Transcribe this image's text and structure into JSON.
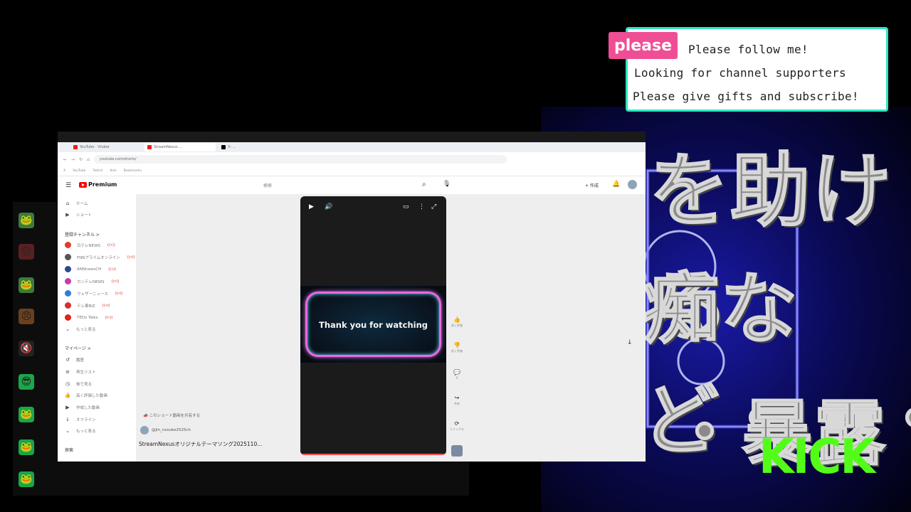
{
  "overlay": {
    "please_tag": "please",
    "lines": [
      "Please follow me!",
      "Looking for channel supporters",
      "Please give gifts and subscribe!"
    ],
    "accent_color": "#2ee6c1",
    "tag_color": "#f04e94"
  },
  "background_text": {
    "line1": "を助ける",
    "line2": "痴など・・・",
    "line3": "・暴露"
  },
  "kick_logo": "KICK",
  "browser": {
    "tabs": [
      {
        "label": "YouTube · Vtuber"
      },
      {
        "label": "StreamNexus ..."
      },
      {
        "label": "X: ..."
      }
    ],
    "url": "youtube.com/shorts/",
    "bookmarks": [
      "X",
      "YouTube",
      "Twitch",
      "Kick",
      "Bookmarks"
    ]
  },
  "youtube": {
    "logo": "Premium",
    "search_placeholder": "検索",
    "create_label": "+ 作成",
    "sidebar": {
      "home": "ホーム",
      "shorts": "ショート",
      "subscriptions_header": "登録チャンネル >",
      "channels": [
        {
          "name": "日テレNEWS",
          "color": "#e33a2f"
        },
        {
          "name": "FNNプライムオンライン",
          "color": "#555555"
        },
        {
          "name": "ANNnewsCH",
          "color": "#2c4a8a"
        },
        {
          "name": "カンテレNEWS",
          "color": "#c63bb0"
        },
        {
          "name": "ウェザーニュース",
          "color": "#2f7fd6"
        },
        {
          "name": "テレ東BIZ",
          "color": "#d6302f"
        },
        {
          "name": "TEDx Talks",
          "color": "#e62117"
        }
      ],
      "more": "もっと見る",
      "you_header": "マイページ >",
      "you_items": [
        "履歴",
        "再生リスト",
        "後で見る",
        "高く評価した動画",
        "作成した動画",
        "オフライン",
        "もっと見る"
      ],
      "explore_header": "探索"
    },
    "player": {
      "thank_text": "Thank you for watching"
    },
    "actions": [
      "高く評価",
      "低く評価",
      "0",
      "共有",
      "リミックス"
    ],
    "share_hint": "このショート動画を共有する",
    "channel_handle": "@Jin_nosuke2525ch",
    "video_title": "StreamNexusオリジナルテーマソング2025110..."
  }
}
